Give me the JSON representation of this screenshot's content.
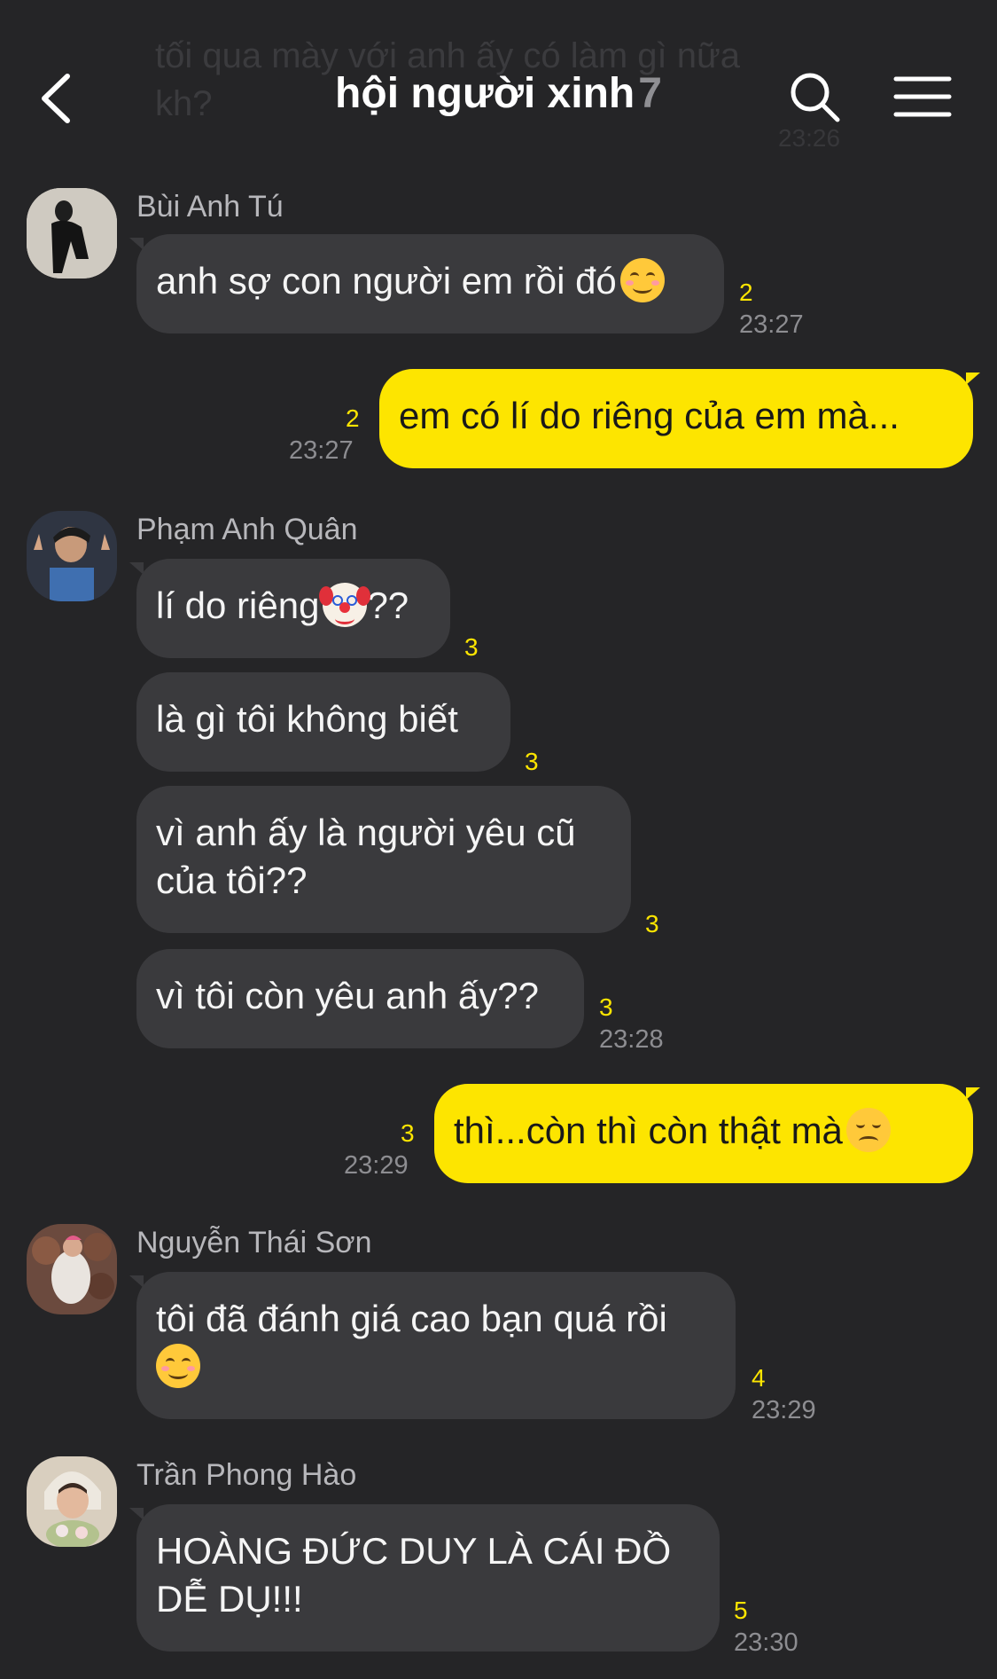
{
  "header": {
    "title": "hội người xinh",
    "member_count": "7",
    "ghost_text": "tối qua mày với anh ấy có làm gì nữa kh?",
    "ghost_time": "23:26"
  },
  "messages": [
    {
      "sender": "Bùi Anh Tú",
      "text": "anh sợ con người em rồi đó",
      "emoji": "smile",
      "unread": "2",
      "time": "23:27"
    },
    {
      "text": "em có lí do riêng của em mà...",
      "unread": "2",
      "time": "23:27"
    },
    {
      "sender": "Phạm Anh Quân",
      "text": "lí do riêng",
      "emoji": "clown",
      "text_after": "??",
      "unread": "3"
    },
    {
      "text": "là gì tôi không biết",
      "unread": "3"
    },
    {
      "text": "vì anh ấy là người yêu cũ của tôi??",
      "unread": "3"
    },
    {
      "text": "vì tôi còn yêu anh ấy??",
      "unread": "3",
      "time": "23:28"
    },
    {
      "text": "thì...còn thì còn thật mà",
      "emoji": "sad",
      "unread": "3",
      "time": "23:29"
    },
    {
      "sender": "Nguyễn Thái Sơn",
      "text": "tôi đã đánh giá cao bạn quá rồi",
      "emoji": "smile",
      "unread": "4",
      "time": "23:29"
    },
    {
      "sender": "Trần Phong Hào",
      "text": "HOÀNG ĐỨC DUY LÀ CÁI ĐỒ DỄ DỤ!!!",
      "unread": "5",
      "time": "23:30"
    }
  ],
  "colors": {
    "background": "#252527",
    "incoming_bubble": "#3a3a3d",
    "outgoing_bubble": "#fde500",
    "unread": "#fde500"
  },
  "icons": [
    "back-arrow-icon",
    "search-icon",
    "menu-icon"
  ]
}
